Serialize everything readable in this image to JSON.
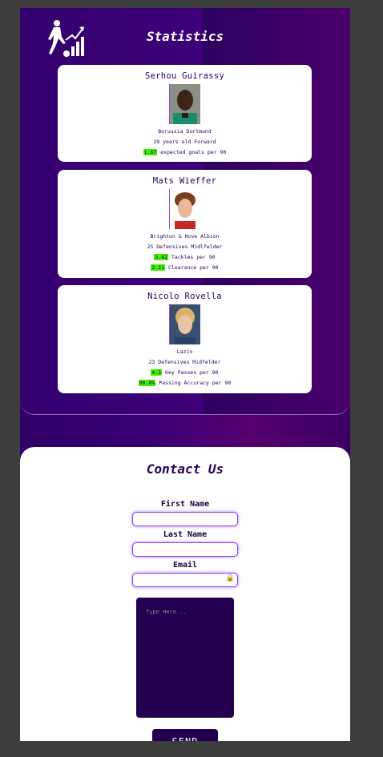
{
  "statistics": {
    "title": "Statistics",
    "players": [
      {
        "name": "Serhou Guirassy",
        "club": "Borussia Dortmund",
        "info": "29 years old Forward",
        "stats": [
          {
            "value": "1.67",
            "label": "expected goals per 90"
          }
        ]
      },
      {
        "name": "Mats Wieffer",
        "club": "Brighton & Hove Albion",
        "info": "25 Defensives Midlfelder",
        "stats": [
          {
            "value": "3.42",
            "label": "Tackles per 90"
          },
          {
            "value": "2.21",
            "label": "Clearance per 90"
          }
        ]
      },
      {
        "name": "Nicolo Rovella",
        "club": "Lazio",
        "info": "23 Defensives Midfelder",
        "stats": [
          {
            "value": "4.5",
            "label": "Key Passes per 90"
          },
          {
            "value": "90.8%",
            "label": "Passing Accuracy per 90"
          }
        ]
      }
    ]
  },
  "contact": {
    "title": "Contact Us",
    "first_name_label": "First Name",
    "last_name_label": "Last Name",
    "email_label": "Email",
    "message_placeholder": "Type Here ..",
    "send_label": "SEND"
  },
  "icons": {
    "logo": "football-player-stats-icon",
    "email_field": "lock-icon"
  },
  "colors": {
    "highlight": "#41f208",
    "brand_purple": "#23004f"
  }
}
